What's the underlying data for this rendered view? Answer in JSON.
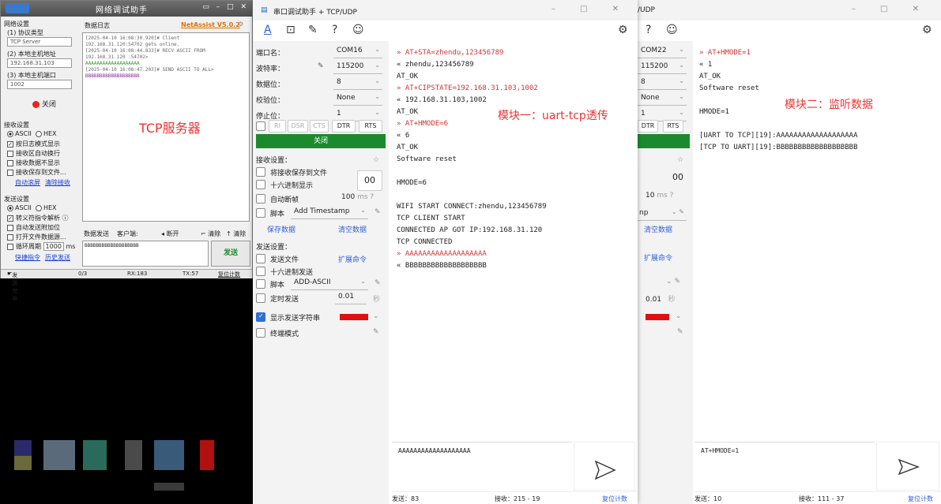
{
  "netassist": {
    "title": "网络调试助手",
    "version": "NetAssist V5.0.2",
    "net_settings": "网络设置",
    "protocol_label": "(1) 协议类型",
    "protocol_value": "TCP Server",
    "host_ip_label": "(2) 本地主机地址",
    "host_ip_value": "192.168.31.103",
    "port_label": "(3) 本地主机端口",
    "port_value": "1002",
    "close_btn": "关闭",
    "recv_settings": "接收设置",
    "ascii": "ASCII",
    "hex": "HEX",
    "recv_opts": [
      "按日志模式显示",
      "接收区自动换行",
      "接收数据不显示",
      "接收保存到文件..."
    ],
    "auto_scroll": "自动滚屏",
    "clear_recv": "清除接收",
    "send_settings": "发送设置",
    "send_opts": [
      "转义符指令解析 ⓘ",
      "自动发送附加位",
      "打开文件数据源...",
      "循环周期"
    ],
    "loop_ms": "1000",
    "loop_unit": "ms",
    "quick_cmd": "快捷指令",
    "history": "历史发送",
    "log_tab": "数据日志",
    "log": [
      {
        "t": "[2025-04-10 16:08:30.920]# Client",
        "c": ""
      },
      {
        "t": "192.168.31.120:54702 gets online.",
        "c": ""
      },
      {
        "t": "[2025-04-10 16:08:44.833]# RECV ASCII FROM",
        "c": ""
      },
      {
        "t": "192.168.31.120 :54702>",
        "c": ""
      },
      {
        "t": "AAAAAAAAAAAAAAAAAAA",
        "c": "recv"
      },
      {
        "t": "[2025-04-10 16:08:47.203]# SEND ASCII TO ALL>",
        "c": ""
      },
      {
        "t": "BBBBBBBBBBBBBBBBBBB",
        "c": "sent"
      }
    ],
    "tab_send": "数据发送",
    "tab_client": "客户端:",
    "disconnect": "断开",
    "clear": "清除",
    "clear2": "清除",
    "send_text": "BBBBBBBBBBBBBBBBBBB",
    "send_btn": "发送",
    "status_done": "发送完毕",
    "status_count": "0/3",
    "status_rx": "RX:183",
    "status_tx": "TX:57",
    "status_reset": "复位计数",
    "overlay_label": "TCP服务器"
  },
  "serial1": {
    "title": "串口调试助手 + TCP/UDP",
    "port_label": "端口名：",
    "port_value": "COM16",
    "baud_label": "波特率：",
    "baud_value": "115200",
    "data_label": "数据位：",
    "data_value": "8",
    "parity_label": "校验位：",
    "parity_value": "None",
    "stop_label": "停止位：",
    "stop_value": "1",
    "signals": [
      "RI",
      "DSR",
      "CTS",
      "DTR",
      "RTS"
    ],
    "close": "关闭",
    "recv_settings": "接收设置：",
    "save_to_file": "将接收保存到文件",
    "hex_display": "十六进制显示",
    "auto_break": "自动断帧",
    "auto_break_ms": "100",
    "ms": "ms",
    "script": "脚本",
    "script_value": "Add Timestamp",
    "save_data": "保存数据",
    "clear_data": "清空数据",
    "send_settings": "发送设置：",
    "send_file": "发送文件",
    "ext_cmd": "扩展命令",
    "hex_send": "十六进制发送",
    "script_send": "脚本",
    "script_send_value": "ADD-ASCII",
    "timed_send": "定时发送",
    "timed_value": "0.01",
    "sec": "秒",
    "show_send": "显示发送字符串",
    "terminal_mode": "终端模式",
    "hex_button": "00",
    "terminal": [
      {
        "t": "» AT+STA=zhendu,123456789",
        "o": true
      },
      {
        "t": "« zhendu,123456789",
        "o": false
      },
      {
        "t": "AT_OK",
        "o": false
      },
      {
        "t": "» AT+CIPSTATE=192.168.31.103,1002",
        "o": true
      },
      {
        "t": "« 192.168.31.103,1002",
        "o": false
      },
      {
        "t": "AT_OK",
        "o": false
      },
      {
        "t": "» AT+HMODE=6",
        "o": true
      },
      {
        "t": "« 6",
        "o": false
      },
      {
        "t": "AT_OK",
        "o": false
      },
      {
        "t": "Software reset",
        "o": false
      },
      {
        "t": "",
        "o": false
      },
      {
        "t": "HMODE=6",
        "o": false
      },
      {
        "t": "",
        "o": false
      },
      {
        "t": "WIFI START CONNECT:zhendu,123456789",
        "o": false
      },
      {
        "t": "TCP CLIENT START",
        "o": false
      },
      {
        "t": "CONNECTED AP GOT IP:192.168.31.120",
        "o": false
      },
      {
        "t": "TCP CONNECTED",
        "o": false
      },
      {
        "t": "» AAAAAAAAAAAAAAAAAAA",
        "o": true
      },
      {
        "t": "« BBBBBBBBBBBBBBBBBBB",
        "o": false
      }
    ],
    "overlay_label": "模块一：uart-tcp透传",
    "send_text": "AAAAAAAAAAAAAAAAAAA",
    "status_sent": "发送：83",
    "status_recv": "接收：215 - 19",
    "status_reset": "复位计数"
  },
  "serial2": {
    "title": "/UDP",
    "port_value": "COM22",
    "baud_value": "115200",
    "data_value": "8",
    "parity_value": "None",
    "stop_value": "1",
    "signals": [
      "DTR",
      "RTS"
    ],
    "auto_break_ms": "10",
    "ms": "ms",
    "script_value": "np",
    "clear_data": "清空数据",
    "ext_cmd": "扩展命令",
    "timed_value": "0.01",
    "sec": "秒",
    "hex_button": "00",
    "terminal": [
      {
        "t": "» AT+HMODE=1",
        "o": true
      },
      {
        "t": "« 1",
        "o": false
      },
      {
        "t": "AT_OK",
        "o": false
      },
      {
        "t": "Software reset",
        "o": false
      },
      {
        "t": "",
        "o": false
      },
      {
        "t": "HMODE=1",
        "o": false
      },
      {
        "t": "",
        "o": false
      },
      {
        "t": "[UART TO TCP][19]:AAAAAAAAAAAAAAAAAAA",
        "o": false
      },
      {
        "t": "[TCP TO UART][19]:BBBBBBBBBBBBBBBBBBB",
        "o": false
      }
    ],
    "overlay_label": "模块二：监听数据",
    "send_text": "AT+HMODE=1",
    "status_sent": "发送：10",
    "status_recv": "接收：111 - 37",
    "status_reset": "复位计数"
  },
  "colors": {
    "accent_red": "#d63333",
    "green": "#1b8a2e",
    "link_blue": "#2f5fd6"
  }
}
